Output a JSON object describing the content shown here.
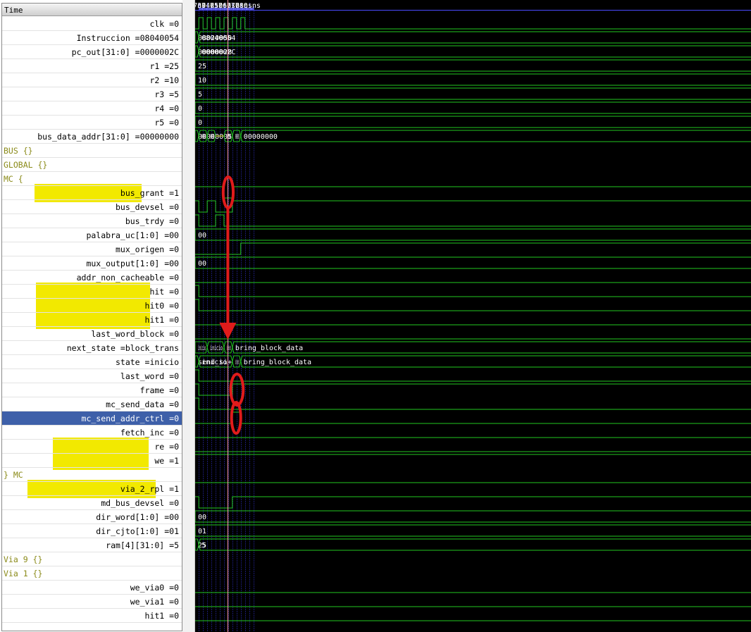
{
  "names_panel": {
    "header": "Time",
    "signals": [
      {
        "id": "clk",
        "label": "clk =0"
      },
      {
        "id": "instruccion",
        "label": "Instruccion =08040054"
      },
      {
        "id": "pc-out",
        "label": "pc_out[31:0] =0000002C"
      },
      {
        "id": "r1",
        "label": "r1 =25"
      },
      {
        "id": "r2",
        "label": "r2 =10"
      },
      {
        "id": "r3",
        "label": "r3 =5"
      },
      {
        "id": "r4",
        "label": "r4 =0"
      },
      {
        "id": "r5",
        "label": "r5 =0"
      },
      {
        "id": "bus-data-addr",
        "label": "bus_data_addr[31:0] =00000000"
      },
      {
        "id": "group-bus",
        "label": "BUS {}",
        "group": true
      },
      {
        "id": "group-global",
        "label": "GLOBAL {}",
        "group": true
      },
      {
        "id": "group-mc-open",
        "label": "MC {",
        "group": true
      },
      {
        "id": "bus-grant",
        "label": "bus_grant =1"
      },
      {
        "id": "bus-devsel",
        "label": "bus_devsel =0"
      },
      {
        "id": "bus-trdy",
        "label": "bus_trdy =0"
      },
      {
        "id": "palabra-uc",
        "label": "palabra_uc[1:0] =00"
      },
      {
        "id": "mux-origen",
        "label": "mux_origen =0"
      },
      {
        "id": "mux-output",
        "label": "mux_output[1:0] =00"
      },
      {
        "id": "addr-non-cacheable",
        "label": "addr_non_cacheable =0"
      },
      {
        "id": "hit",
        "label": "hit =0"
      },
      {
        "id": "hit0",
        "label": "hit0 =0"
      },
      {
        "id": "hit1",
        "label": "hit1 =0"
      },
      {
        "id": "last-word-block",
        "label": "last_word_block =0"
      },
      {
        "id": "next-state",
        "label": "next_state =block_trans"
      },
      {
        "id": "state",
        "label": "state =inicio"
      },
      {
        "id": "last-word",
        "label": "last_word =0"
      },
      {
        "id": "frame",
        "label": "frame =0"
      },
      {
        "id": "mc-send-data",
        "label": "mc_send_data =0"
      },
      {
        "id": "mc-send-addr-ctrl",
        "label": "mc_send_addr_ctrl =0",
        "selected": true
      },
      {
        "id": "fetch-inc",
        "label": "fetch_inc =0"
      },
      {
        "id": "re",
        "label": "re =0"
      },
      {
        "id": "we",
        "label": "we =1"
      },
      {
        "id": "group-mc-close",
        "label": "} MC",
        "group": true
      },
      {
        "id": "via-2-rpl",
        "label": "via_2_rpl =1"
      },
      {
        "id": "md-bus-devsel",
        "label": "md_bus_devsel =0"
      },
      {
        "id": "dir-word",
        "label": "dir_word[1:0] =00"
      },
      {
        "id": "dir-cjto",
        "label": "dir_cjto[1:0] =01"
      },
      {
        "id": "ram4",
        "label": "ram[4][31:0] =5"
      },
      {
        "id": "group-via9",
        "label": "Via 9 {}",
        "group": true
      },
      {
        "id": "group-via1",
        "label": "Via 1 {}",
        "group": true
      },
      {
        "id": "we-via0",
        "label": "we_via0 =0"
      },
      {
        "id": "we-via1",
        "label": "we_via1 =0"
      },
      {
        "id": "hit1-b",
        "label": "hit1 =0"
      }
    ]
  },
  "timeline": {
    "unit": "ns",
    "ticks": [
      "730 ns",
      "740 ns",
      "750 ns",
      "760 ns",
      "770 ns",
      "780 ns"
    ],
    "left_label": "ns",
    "view_start_ns": 725.6,
    "ns_per_major": 10,
    "cursor_ns": 764.6
  },
  "colors": {
    "background": "#000000",
    "wave": "#22c81f",
    "bus_undefined": "#b8b800",
    "grid": "#1a1a6e",
    "text": "#ffffff",
    "cursor": "#ff9aa8",
    "annotation": "#e01b1b",
    "highlight": "#f2e900",
    "selected_row": "#3e60a9",
    "group_label": "#8b8b1a"
  },
  "waves": [
    {
      "row": 0,
      "type": "bit",
      "init": 0,
      "edges": [
        730,
        735,
        740,
        745,
        750,
        755,
        760,
        765,
        770,
        775,
        780,
        785
      ]
    },
    {
      "row": 1,
      "type": "bus",
      "segs": [
        {
          "t": 725.6,
          "v": "08020050"
        },
        {
          "t": 730,
          "v": "08040054"
        }
      ]
    },
    {
      "row": 2,
      "type": "bus",
      "segs": [
        {
          "t": 725.6,
          "v": "00000028"
        },
        {
          "t": 730,
          "v": "0000002C"
        }
      ]
    },
    {
      "row": 3,
      "type": "bus",
      "segs": [
        {
          "t": 725.6,
          "v": "25"
        }
      ]
    },
    {
      "row": 4,
      "type": "bus",
      "segs": [
        {
          "t": 725.6,
          "v": "10"
        }
      ]
    },
    {
      "row": 5,
      "type": "bus",
      "segs": [
        {
          "t": 725.6,
          "v": "5"
        }
      ]
    },
    {
      "row": 6,
      "type": "bus",
      "segs": [
        {
          "t": 725.6,
          "v": "0"
        }
      ]
    },
    {
      "row": 7,
      "type": "bus",
      "segs": [
        {
          "t": 725.6,
          "v": "0"
        }
      ]
    },
    {
      "row": 8,
      "type": "bus",
      "segs": [
        {
          "t": 725.6,
          "v": "00000005"
        },
        {
          "t": 730,
          "v": "00000000"
        },
        {
          "t": 740,
          "v": "10000000"
        },
        {
          "t": 750,
          "v": "",
          "z": true
        },
        {
          "t": 760,
          "v": "00000000"
        },
        {
          "t": 770,
          "v": "00000050"
        },
        {
          "t": 780,
          "v": "00000000"
        }
      ]
    },
    {
      "row": 12,
      "type": "bit",
      "init": 1,
      "edges": [
        760,
        770
      ]
    },
    {
      "row": 13,
      "type": "bit",
      "init": 1,
      "edges": [
        730,
        740,
        750,
        770
      ]
    },
    {
      "row": 14,
      "type": "bit",
      "init": 1,
      "edges": [
        730,
        750,
        760
      ]
    },
    {
      "row": 15,
      "type": "bus",
      "segs": [
        {
          "t": 725.6,
          "v": "00"
        }
      ]
    },
    {
      "row": 16,
      "type": "bit",
      "init": 0,
      "edges": [
        780
      ]
    },
    {
      "row": 17,
      "type": "bus",
      "segs": [
        {
          "t": 725.6,
          "v": "00"
        }
      ]
    },
    {
      "row": 18,
      "type": "bit",
      "init": 0,
      "edges": []
    },
    {
      "row": 19,
      "type": "bit",
      "init": 1,
      "edges": [
        730
      ]
    },
    {
      "row": 20,
      "type": "bit",
      "init": 1,
      "edges": [
        730
      ]
    },
    {
      "row": 21,
      "type": "bit",
      "init": 0,
      "edges": []
    },
    {
      "row": 22,
      "type": "bit",
      "init": 0,
      "edges": []
    },
    {
      "row": 23,
      "type": "bus",
      "segs": [
        {
          "t": 725.6,
          "v": "inicio"
        },
        {
          "t": 740,
          "v": "inicio"
        },
        {
          "t": 760,
          "v": "block_transfer_addr"
        },
        {
          "t": 770,
          "v": "bring_block_data"
        }
      ]
    },
    {
      "row": 24,
      "type": "bus",
      "segs": [
        {
          "t": 725.6,
          "v": "send_si+"
        },
        {
          "t": 730,
          "v": "inicio"
        },
        {
          "t": 770,
          "v": "block_transfer_addr"
        },
        {
          "t": 780,
          "v": "bring_block_data"
        }
      ]
    },
    {
      "row": 25,
      "type": "bit",
      "init": 1,
      "edges": [
        730
      ]
    },
    {
      "row": 26,
      "type": "bit",
      "init": 1,
      "edges": [
        730,
        770
      ]
    },
    {
      "row": 27,
      "type": "bit",
      "init": 1,
      "edges": [
        730
      ]
    },
    {
      "row": 28,
      "type": "bit",
      "init": 0,
      "edges": [
        770,
        780
      ]
    },
    {
      "row": 29,
      "type": "bit",
      "init": 0,
      "edges": []
    },
    {
      "row": 30,
      "type": "bit",
      "init": 0,
      "edges": []
    },
    {
      "row": 31,
      "type": "bit",
      "init": 1,
      "edges": []
    },
    {
      "row": 33,
      "type": "bit",
      "init": 1,
      "edges": []
    },
    {
      "row": 34,
      "type": "bit",
      "init": 1,
      "edges": [
        730,
        770
      ]
    },
    {
      "row": 35,
      "type": "bus",
      "segs": [
        {
          "t": 725.6,
          "v": "00"
        }
      ]
    },
    {
      "row": 36,
      "type": "bus",
      "segs": [
        {
          "t": 725.6,
          "v": "01"
        }
      ]
    },
    {
      "row": 37,
      "type": "bus",
      "segs": [
        {
          "t": 725.6,
          "v": "25"
        },
        {
          "t": 730,
          "v": "5"
        }
      ]
    },
    {
      "row": 40,
      "type": "bit",
      "init": 0,
      "edges": []
    },
    {
      "row": 41,
      "type": "bit",
      "init": 0,
      "edges": []
    },
    {
      "row": 42,
      "type": "bit",
      "init": 0,
      "edges": []
    }
  ],
  "annotations": {
    "highlighted_rows": [
      [
        12,
        12
      ],
      [
        19,
        21
      ],
      [
        30,
        31
      ],
      [
        33,
        33
      ]
    ],
    "ellipses": [
      {
        "id": "bus-grant-ellipse",
        "t0": 759,
        "t1": 771,
        "row": 12
      },
      {
        "id": "frame-ellipse",
        "t0": 768,
        "t1": 783,
        "row": 26
      },
      {
        "id": "mc-send-addr-ctrl-ellipse",
        "t0": 769,
        "t1": 780,
        "row": 28
      }
    ],
    "arrow": {
      "from_row": 12,
      "to_row": 23,
      "t": 764.6
    }
  }
}
